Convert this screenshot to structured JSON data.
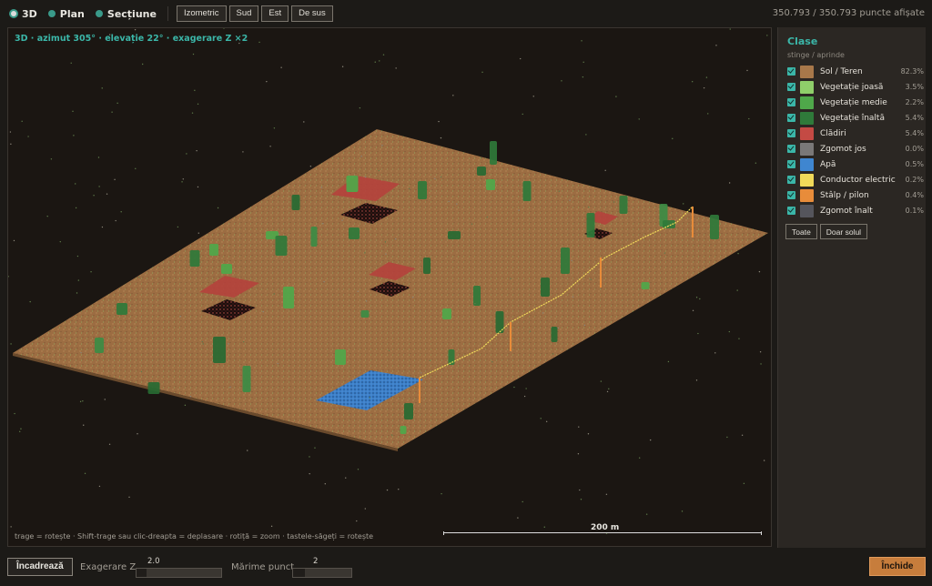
{
  "toolbar": {
    "modes": [
      {
        "label": "3D",
        "active": true
      },
      {
        "label": "Plan",
        "active": false
      },
      {
        "label": "Secțiune",
        "active": false
      }
    ],
    "views": [
      "Izometric",
      "Sud",
      "Est",
      "De sus"
    ],
    "point_count": "350.793 / 350.793 puncte afișate"
  },
  "viewport": {
    "camera_info": "3D · azimut 305° · elevație 22° · exagerare Z ×2",
    "scale_label": "200 m",
    "hint": "trage = rotește · Shift-trage sau clic-dreapta = deplasare · rotiță = zoom · tastele-săgeți = rotește"
  },
  "panel": {
    "title": "Clase",
    "subtitle": "stinge / aprinde",
    "classes": [
      {
        "name": "Sol / Teren",
        "pct": "82.3%",
        "color": "#a8784a",
        "checked": true
      },
      {
        "name": "Vegetație joasă",
        "pct": "3.5%",
        "color": "#8fcf6a",
        "checked": true
      },
      {
        "name": "Vegetație medie",
        "pct": "2.2%",
        "color": "#4fa84a",
        "checked": true
      },
      {
        "name": "Vegetație înaltă",
        "pct": "5.4%",
        "color": "#2f7a3a",
        "checked": true
      },
      {
        "name": "Clădiri",
        "pct": "5.4%",
        "color": "#c44a44",
        "checked": true
      },
      {
        "name": "Zgomot jos",
        "pct": "0.0%",
        "color": "#7a7878",
        "checked": true
      },
      {
        "name": "Apă",
        "pct": "0.5%",
        "color": "#3f86d0",
        "checked": true
      },
      {
        "name": "Conductor electric",
        "pct": "0.2%",
        "color": "#f0da5a",
        "checked": true
      },
      {
        "name": "Stâlp / pilon",
        "pct": "0.4%",
        "color": "#e88c3a",
        "checked": true
      },
      {
        "name": "Zgomot înalt",
        "pct": "0.1%",
        "color": "#55555c",
        "checked": true
      }
    ],
    "btn_all": "Toate",
    "btn_ground": "Doar solul"
  },
  "bottom": {
    "frame_label": "Încadrează",
    "zexag_label": "Exagerare Z",
    "zexag_value": "2.0",
    "zexag_fraction": 0.12,
    "psize_label": "Mărime punct",
    "psize_value": "2",
    "psize_fraction": 0.2,
    "close_label": "Închide"
  }
}
